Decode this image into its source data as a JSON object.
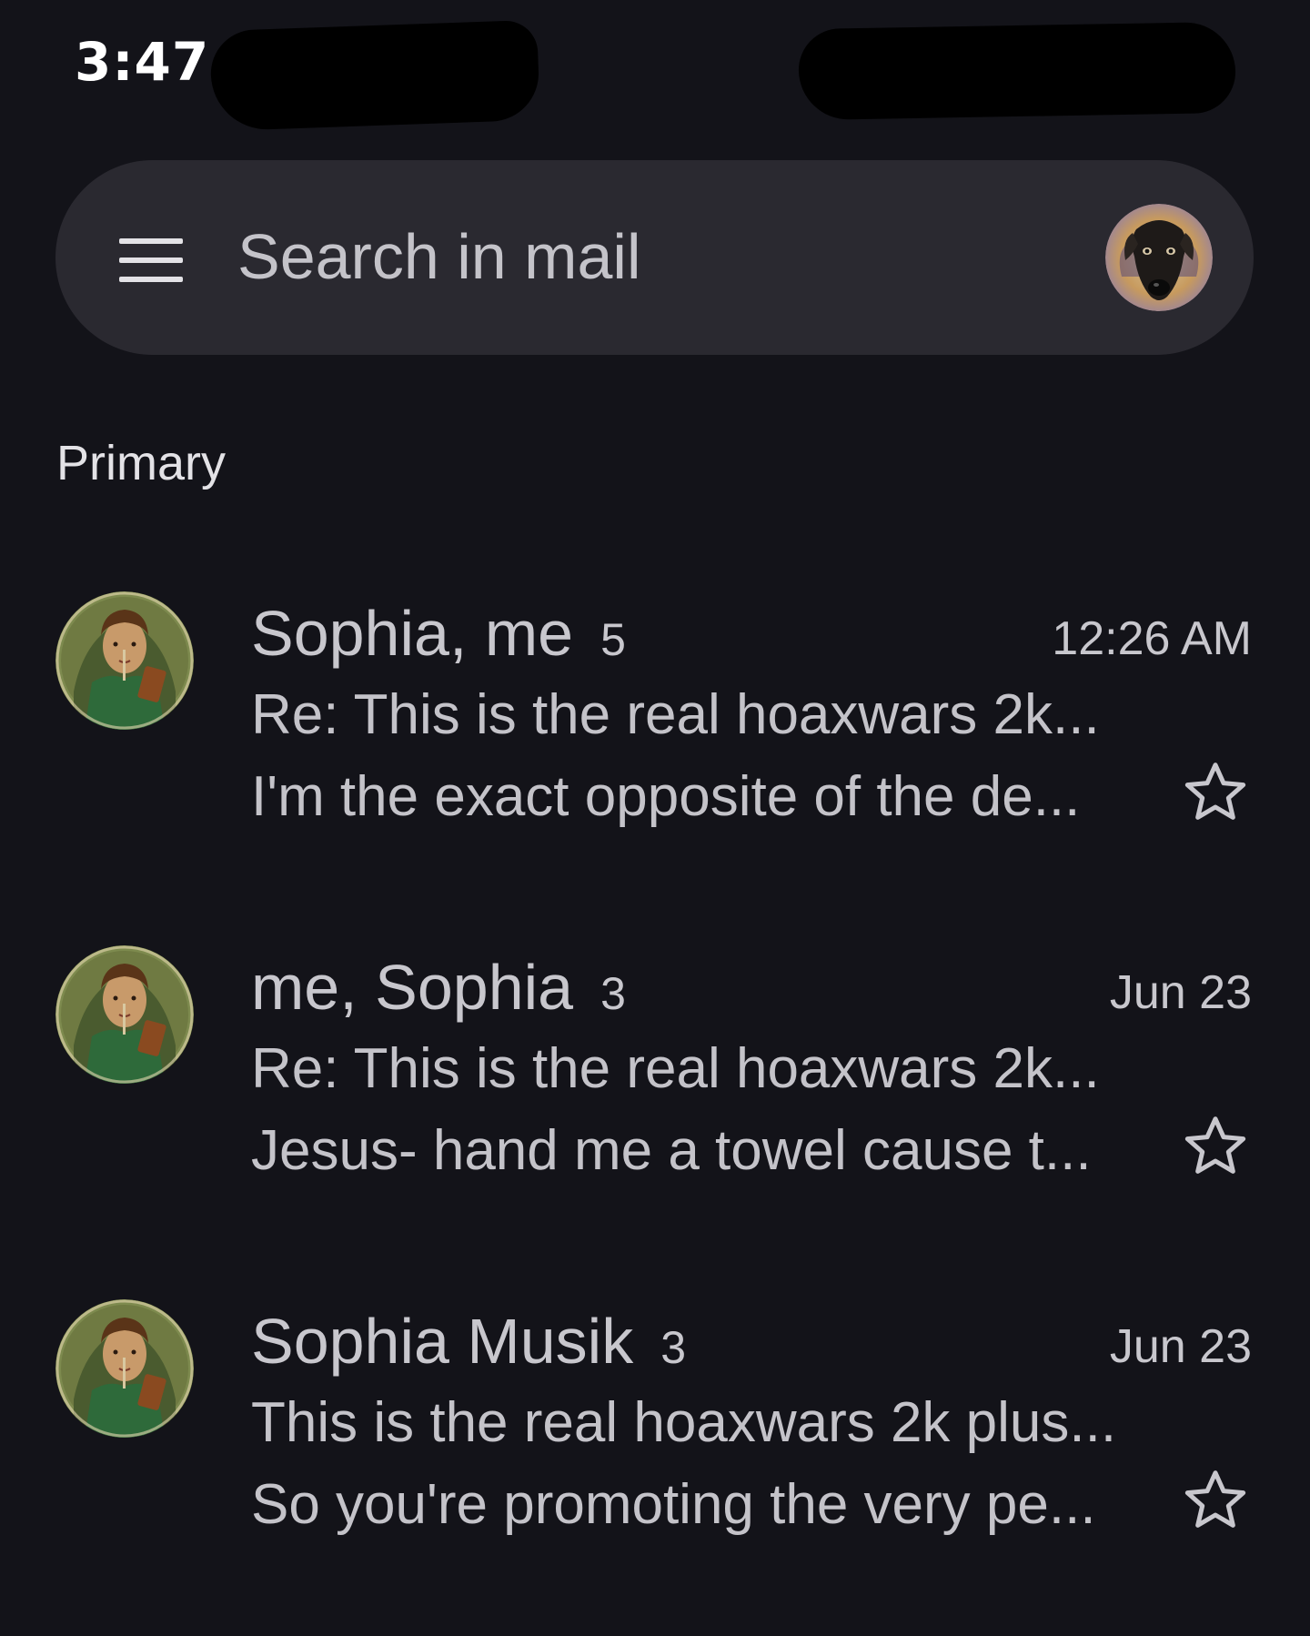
{
  "status_bar": {
    "time": "3:47"
  },
  "search": {
    "placeholder": "Search in mail",
    "menu_icon": "menu-icon",
    "account_icon": "account-avatar-dog"
  },
  "section": {
    "label": "Primary"
  },
  "threads": [
    {
      "senders": "Sophia, me",
      "count": "5",
      "date": "12:26 AM",
      "subject": "Re: This is the real hoaxwars 2k...",
      "snippet": "I'm the exact opposite of the de...",
      "starred": false
    },
    {
      "senders": "me, Sophia",
      "count": "3",
      "date": "Jun 23",
      "subject": "Re: This is the real hoaxwars 2k...",
      "snippet": "Jesus- hand me a towel cause t...",
      "starred": false
    },
    {
      "senders": "Sophia Musik",
      "count": "3",
      "date": "Jun 23",
      "subject": "This is the real hoaxwars 2k plus...",
      "snippet": "So you're promoting the very pe...",
      "starred": false
    }
  ],
  "colors": {
    "background": "#131319",
    "search_bar": "#2a2930",
    "text": "#c8c7cd"
  }
}
